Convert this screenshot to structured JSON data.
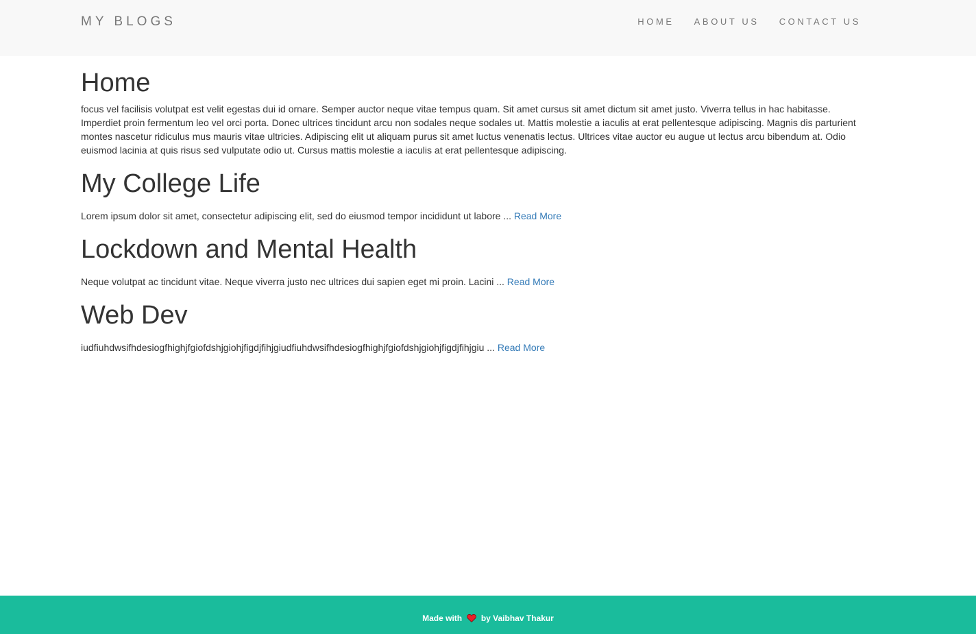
{
  "nav": {
    "brand": "MY BLOGS",
    "links": [
      "HOME",
      "ABOUT US",
      "CONTACT US"
    ]
  },
  "home": {
    "title": "Home",
    "intro": "focus vel facilisis volutpat est velit egestas dui id ornare. Semper auctor neque vitae tempus quam. Sit amet cursus sit amet dictum sit amet justo. Viverra tellus in hac habitasse. Imperdiet proin fermentum leo vel orci porta. Donec ultrices tincidunt arcu non sodales neque sodales ut. Mattis molestie a iaculis at erat pellentesque adipiscing. Magnis dis parturient montes nascetur ridiculus mus mauris vitae ultricies. Adipiscing elit ut aliquam purus sit amet luctus venenatis lectus. Ultrices vitae auctor eu augue ut lectus arcu bibendum at. Odio euismod lacinia at quis risus sed vulputate odio ut. Cursus mattis molestie a iaculis at erat pellentesque adipiscing."
  },
  "posts": [
    {
      "title": "My College Life",
      "excerpt": "Lorem ipsum dolor sit amet, consectetur adipiscing elit, sed do eiusmod tempor incididunt ut labore ... ",
      "read_more": "Read More"
    },
    {
      "title": "Lockdown and Mental Health",
      "excerpt": "Neque volutpat ac tincidunt vitae. Neque viverra justo nec ultrices dui sapien eget mi proin. Lacini ... ",
      "read_more": "Read More"
    },
    {
      "title": "Web Dev",
      "excerpt": "iudfiuhdwsifhdesiogfhighjfgiofdshjgiohjfigdjfihjgiudfiuhdwsifhdesiogfhighjfgiofdshjgiohjfigdjfihjgiu ... ",
      "read_more": "Read More"
    }
  ],
  "footer": {
    "prefix": "Made with",
    "icon": "heart-icon",
    "suffix": "by Vaibhav Thakur"
  },
  "colors": {
    "navbar_bg": "#f8f8f8",
    "footer_bg": "#1abc9c",
    "link": "#337ab7",
    "heart": "#e8202a"
  }
}
